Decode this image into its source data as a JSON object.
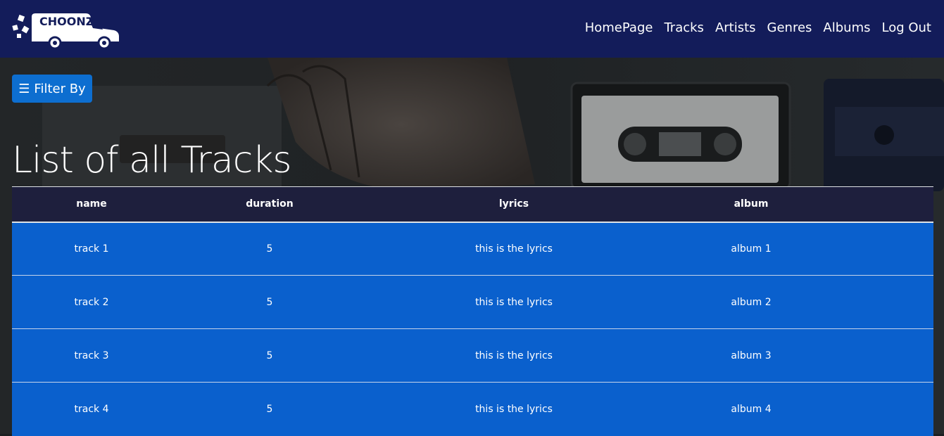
{
  "brand": {
    "logo_text": "CHOONZ",
    "logo_icon": "delivery-van-icon"
  },
  "nav": {
    "items": [
      {
        "label": "HomePage"
      },
      {
        "label": "Tracks"
      },
      {
        "label": "Artists"
      },
      {
        "label": "Genres"
      },
      {
        "label": "Albums"
      },
      {
        "label": "Log Out"
      }
    ]
  },
  "filter": {
    "icon": "menu-icon",
    "icon_glyph": "☰",
    "label": "Filter By"
  },
  "page": {
    "title": "List of all Tracks"
  },
  "table": {
    "headers": [
      "name",
      "duration",
      "lyrics",
      "album"
    ],
    "rows": [
      [
        "track 1",
        "5",
        "this is the lyrics",
        "album 1"
      ],
      [
        "track 2",
        "5",
        "this is the lyrics",
        "album 2"
      ],
      [
        "track 3",
        "5",
        "this is the lyrics",
        "album 3"
      ],
      [
        "track 4",
        "5",
        "this is the lyrics",
        "album 4"
      ]
    ]
  },
  "colors": {
    "navbar": "#131c5a",
    "accent": "#0d6ed0",
    "row": "#0a60cd",
    "header_row": "#1e1f3d"
  }
}
